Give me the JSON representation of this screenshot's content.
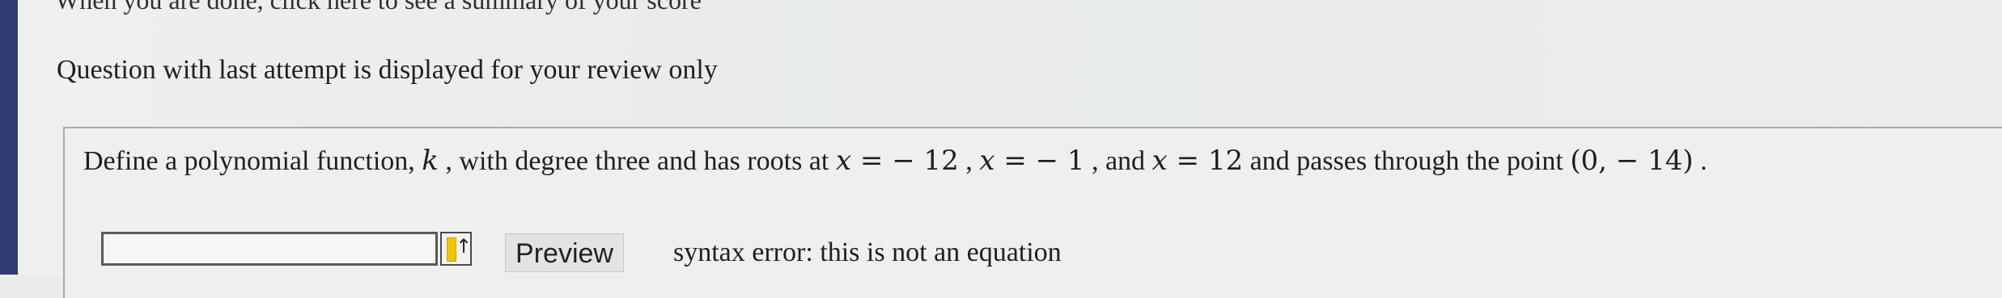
{
  "page": {
    "summary_link": "When you are done, click here to see a summary of your score",
    "review_note": "Question with last attempt is displayed for your review only"
  },
  "question": {
    "intro": "Define a polynomial function, ",
    "function_symbol": "k",
    "degree_text": " , with degree three and has roots at ",
    "var1": "x",
    "eq1": " = ",
    "root1": "− 12",
    "sep1": " , ",
    "var2": "x",
    "eq2": " = ",
    "root2": "− 1",
    "sep2": " , and ",
    "var3": "x",
    "eq3": " = ",
    "root3": "12",
    "tail": " and passes through the point ",
    "point": "(0,  − 14)",
    "period": " ."
  },
  "answer": {
    "input_value": "",
    "preview_label": "Preview",
    "status_text": "syntax error: this is not an equation"
  },
  "icons": {
    "input_status_icon": "yellow-bar-up-arrow-icon"
  },
  "colors": {
    "left_rail": "#2f3a73",
    "indicator": "#f4c400"
  }
}
